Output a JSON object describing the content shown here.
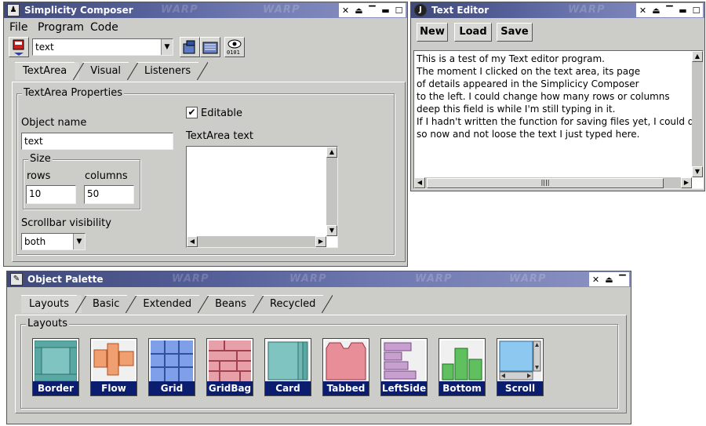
{
  "composer": {
    "title": "Simplicity Composer",
    "menu": [
      "File",
      "Program",
      "Code"
    ],
    "object_select_value": "text",
    "tabs": [
      "TextArea",
      "Visual",
      "Listeners"
    ],
    "group_title": "TextArea Properties",
    "object_name_label": "Object name",
    "object_name_value": "text",
    "size_group_title": "Size",
    "rows_label": "rows",
    "rows_value": "10",
    "columns_label": "columns",
    "columns_value": "50",
    "scrollbar_label": "Scrollbar visibility",
    "scrollbar_value": "both",
    "editable_label": "Editable",
    "editable_checked": true,
    "textarea_text_label": "TextArea text"
  },
  "text_editor": {
    "title": "Text Editor",
    "buttons": {
      "new": "New",
      "load": "Load",
      "save": "Save"
    },
    "text": "This is a test of my Text editor program.\nThe moment I clicked on the text area, its page\nof details appeared in the Simplicicy Composer\nto the left. I could change how many rows or columns\ndeep this field is while I'm still typing in it.\nIf I hadn't written the function for saving files yet, I could do\nso now and not loose the text I just typed here."
  },
  "palette": {
    "title": "Object Palette",
    "tabs": [
      "Layouts",
      "Basic",
      "Extended",
      "Beans",
      "Recycled"
    ],
    "group_title": "Layouts",
    "items": [
      "Border",
      "Flow",
      "Grid",
      "GridBag",
      "Card",
      "Tabbed",
      "LeftSide",
      "Bottom",
      "Scroll"
    ]
  },
  "watermark": "WARP",
  "colors": {
    "titlebar": "#4a5590",
    "window_bg": "#ccccc8",
    "palette_caption": "#0a1d6e"
  }
}
